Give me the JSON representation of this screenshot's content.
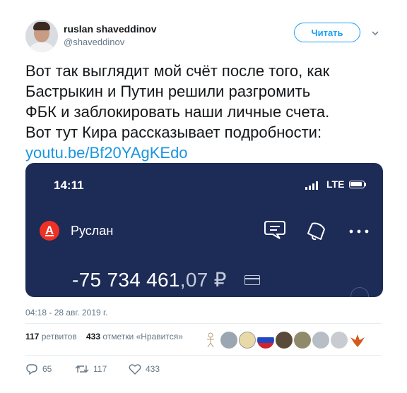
{
  "header": {
    "display_name": "ruslan shaveddinov",
    "handle": "@shaveddinov",
    "follow_label": "Читать"
  },
  "tweet": {
    "lines": [
      "Вот так выглядит мой счёт после того, как",
      "Бастрыкин и Путин решили разгромить",
      "ФБК и заблокировать наши личные счета.",
      "Вот тут Кира рассказывает подробности:"
    ],
    "link": "youtu.be/Bf20YAgKEdo"
  },
  "screenshot": {
    "time": "14:11",
    "network": "LTE",
    "bank_logo_letter": "А",
    "account_name": "Руслан",
    "balance_main": "-75 734 461",
    "balance_cents": ",07 ₽",
    "icons": [
      "chat-icon",
      "bell-icon",
      "more-icon",
      "card-icon"
    ],
    "colors": {
      "background": "#1d2b57",
      "bank_red": "#ef3124"
    }
  },
  "timestamp": "04:18 - 28 авг. 2019 г.",
  "stats": {
    "retweets_count": "117",
    "retweets_label": "ретвитов",
    "likes_count": "433",
    "likes_label": "отметки «Нравится»"
  },
  "actions": {
    "replies": "65",
    "retweets": "117",
    "likes": "433"
  },
  "colors": {
    "accent": "#1da1f2",
    "link": "#1b95e0",
    "muted": "#657786"
  }
}
